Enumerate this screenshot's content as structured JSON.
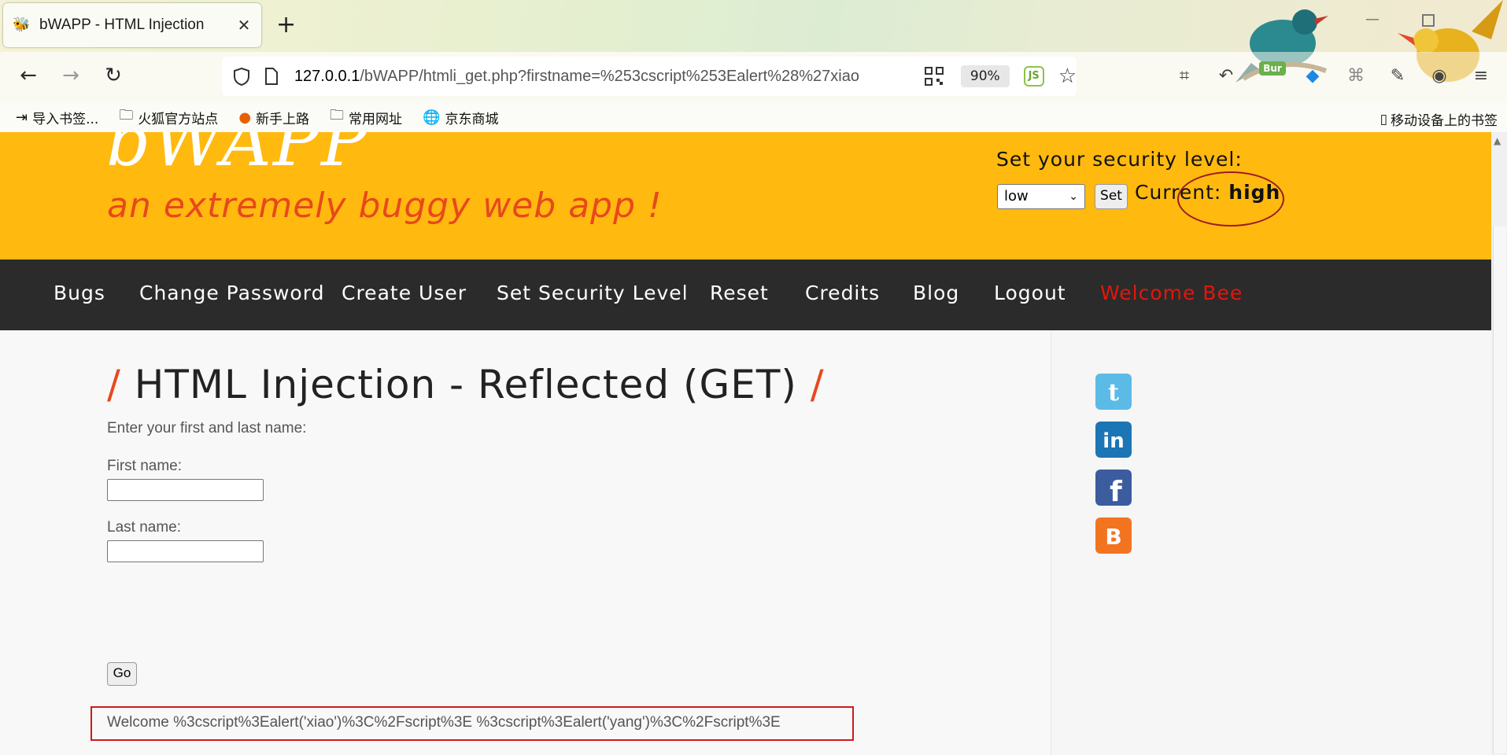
{
  "browser": {
    "tab_title": "bWAPP - HTML Injection",
    "tab_close": "✕",
    "new_tab": "+",
    "url_host": "127.0.0.1",
    "url_path": "/bWAPP/htmli_get.php?firstname=%253cscript%253Ealert%28%27xiao",
    "zoom": "90%",
    "js_badge": "JS",
    "ext_bur_badge": "Bur"
  },
  "bookmarks": {
    "items": [
      {
        "icon": "import-icon",
        "label": "导入书签..."
      },
      {
        "icon": "folder-icon",
        "label": "火狐官方站点"
      },
      {
        "icon": "firefox-icon",
        "label": "新手上路"
      },
      {
        "icon": "folder-icon",
        "label": "常用网址"
      },
      {
        "icon": "globe-icon",
        "label": "京东商城"
      }
    ],
    "mobile": "移动设备上的书签"
  },
  "header": {
    "logo": "bWAPP",
    "tagline": "an extremely buggy web app !",
    "security_label": "Set your security level:",
    "security_select": "low",
    "set_button": "Set",
    "current_label": "Current:",
    "current_value": "high"
  },
  "menu": [
    "Bugs",
    "Change Password",
    "Create User",
    "Set Security Level",
    "Reset",
    "Credits",
    "Blog",
    "Logout",
    "Welcome Bee"
  ],
  "main": {
    "title_slash_left": "/",
    "title": "HTML Injection - Reflected (GET)",
    "title_slash_right": "/",
    "intro": "Enter your first and last name:",
    "first_name_label": "First name:",
    "last_name_label": "Last name:",
    "go_button": "Go",
    "result": "Welcome %3cscript%3Ealert('xiao')%3C%2Fscript%3E %3cscript%3Ealert('yang')%3C%2Fscript%3E"
  },
  "social": [
    "twitter-icon",
    "linkedin-icon",
    "facebook-icon",
    "blogger-icon"
  ],
  "colors": {
    "header_bg": "#ffb90f",
    "menu_bg": "#2b2b2b",
    "tagline": "#e8481c",
    "welcome": "#e3160b",
    "highlight_box": "#cc1a1a"
  }
}
